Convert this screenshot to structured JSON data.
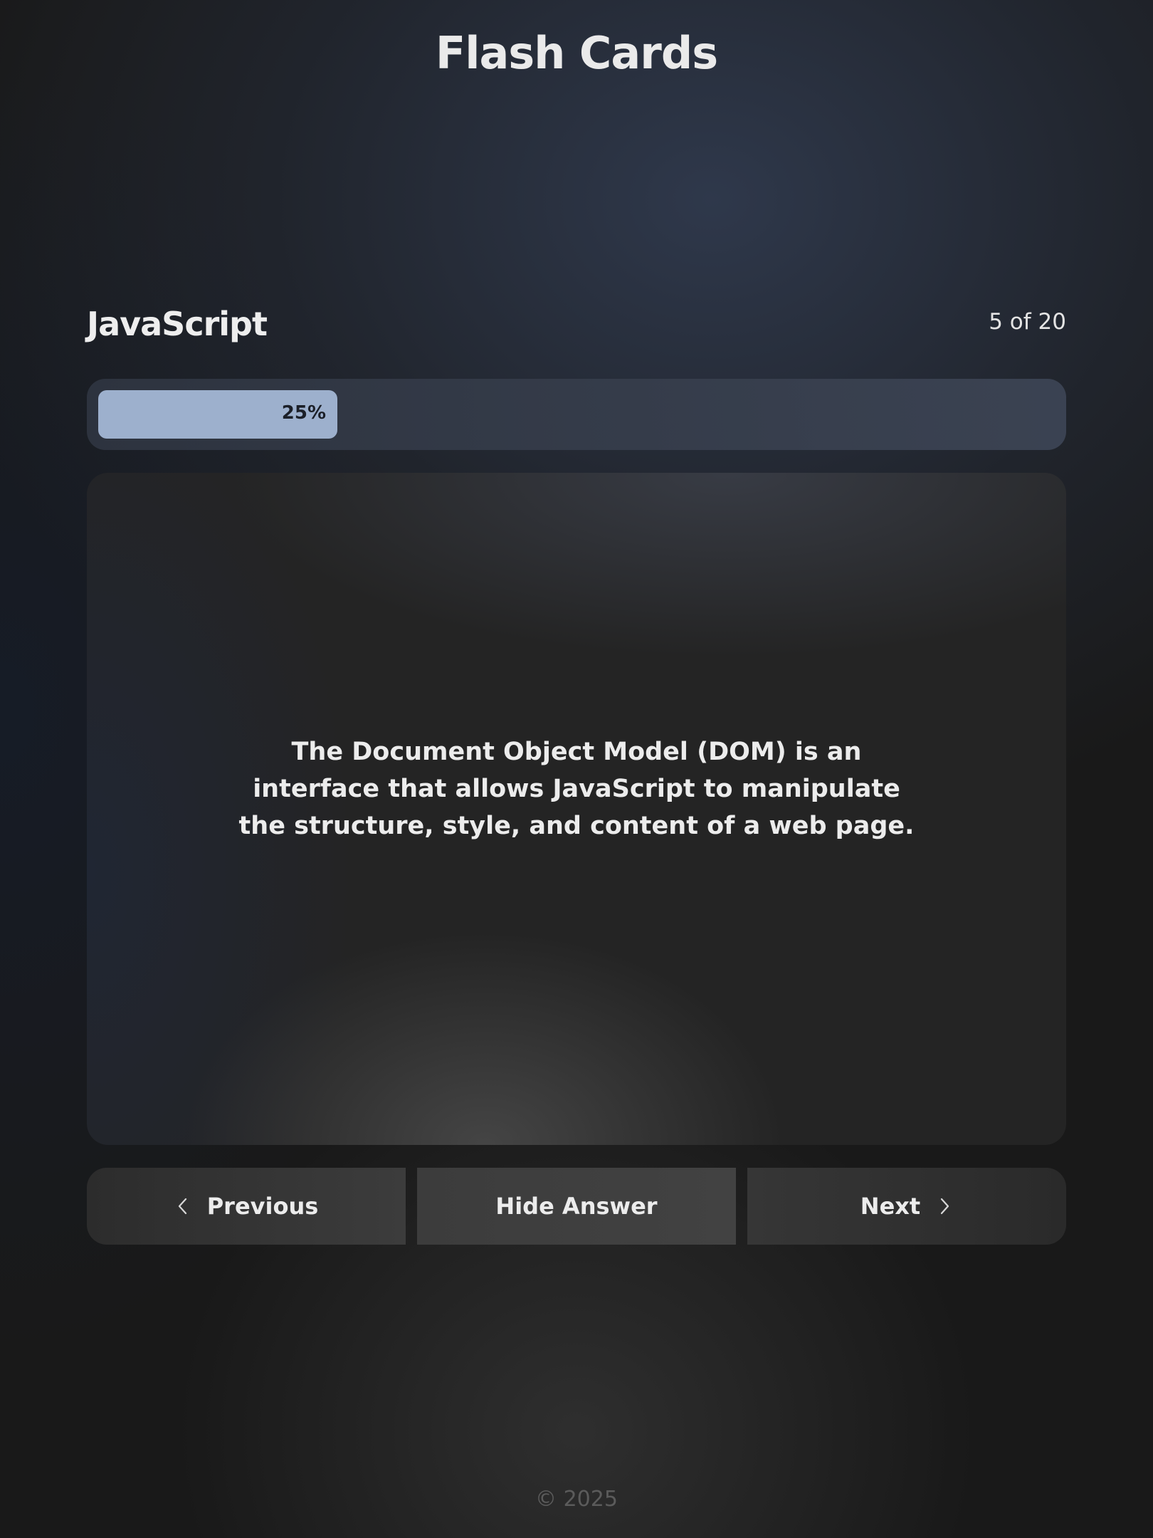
{
  "app": {
    "title": "Flash Cards"
  },
  "deck": {
    "name": "JavaScript",
    "counter": "5 of 20"
  },
  "progress": {
    "value_percent": 25,
    "label": "25%",
    "fill_color": "#9db0cd"
  },
  "card": {
    "text": "The Document Object Model (DOM) is an interface that allows JavaScript to manipulate the structure, style, and content of a web page."
  },
  "controls": {
    "previous_label": "Previous",
    "previous_icon": "chevron-left-icon",
    "toggle_label": "Hide Answer",
    "next_label": "Next",
    "next_icon": "chevron-right-icon"
  },
  "footer": {
    "text": "© 2025"
  },
  "colors": {
    "background": "#191919",
    "accent": "#9db0cd",
    "text": "#ececec"
  }
}
